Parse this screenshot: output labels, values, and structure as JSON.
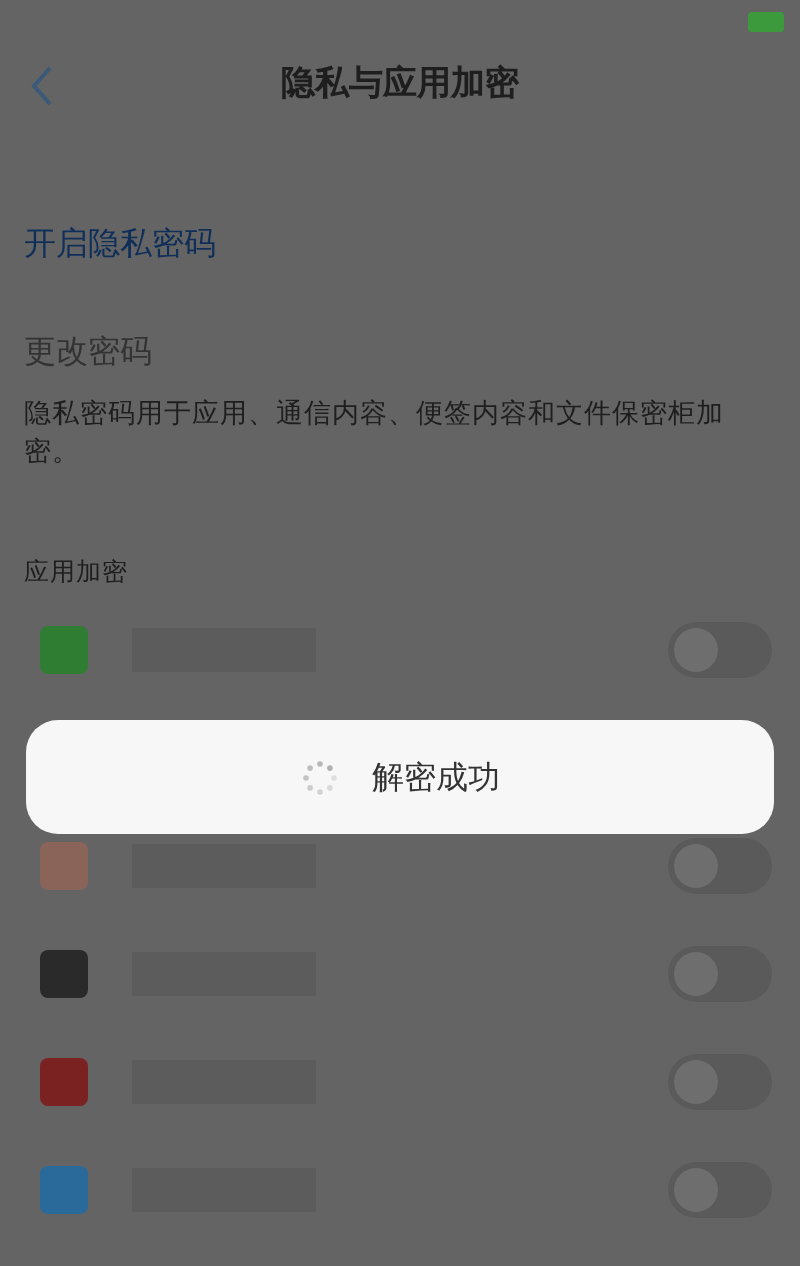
{
  "header": {
    "title": "隐私与应用加密"
  },
  "privacy_password": {
    "enable": "开启隐私密码",
    "change": "更改密码",
    "description": "隐私密码用于应用、通信内容、便签内容和文件保密柜加密。"
  },
  "app_encryption": {
    "heading": "应用加密",
    "apps": [
      {
        "color": "#2e7d32",
        "on": false
      },
      {
        "color": "#8a6458",
        "on": false
      },
      {
        "color": "#2a2a2a",
        "on": false
      },
      {
        "color": "#7a2222",
        "on": false
      },
      {
        "color": "#2a6a9a",
        "on": false
      }
    ]
  },
  "toast": {
    "text": "解密成功"
  }
}
